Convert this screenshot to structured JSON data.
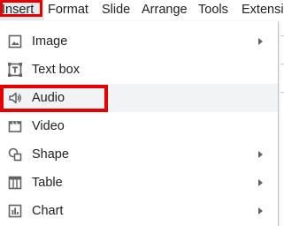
{
  "menubar": {
    "items": [
      {
        "label": "Insert"
      },
      {
        "label": "Format"
      },
      {
        "label": "Slide"
      },
      {
        "label": "Arrange"
      },
      {
        "label": "Tools"
      },
      {
        "label": "Extensi"
      }
    ]
  },
  "insert_menu": {
    "items": [
      {
        "label": "Image",
        "icon": "image-icon",
        "has_submenu": true
      },
      {
        "label": "Text box",
        "icon": "text-box-icon",
        "has_submenu": false
      },
      {
        "label": "Audio",
        "icon": "audio-icon",
        "has_submenu": false,
        "highlighted": true
      },
      {
        "label": "Video",
        "icon": "video-icon",
        "has_submenu": false
      },
      {
        "label": "Shape",
        "icon": "shape-icon",
        "has_submenu": true
      },
      {
        "label": "Table",
        "icon": "table-icon",
        "has_submenu": true
      },
      {
        "label": "Chart",
        "icon": "chart-icon",
        "has_submenu": true
      }
    ]
  },
  "colors": {
    "annotation_red": "#e60000",
    "hover_gray": "#f1f3f4",
    "icon_gray": "#5f6368",
    "text": "#202124"
  }
}
